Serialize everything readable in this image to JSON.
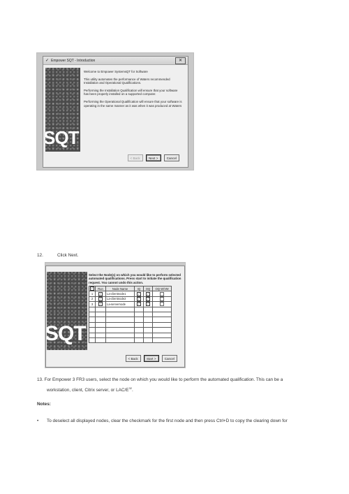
{
  "screenshot_intro": {
    "title": "Empower SQT - Introduction",
    "logo_text": "SQT",
    "paragraphs": [
      "Welcome to Empower SystemsQT for Software",
      "This utility automates the performance of Waters recommended Installation and Operational Qualifications.",
      "Performing the Installation Qualification will ensure that your software has been properly installed on a supported computer.",
      "Performing the Operational Qualification will ensure that your software is operating in the same manner as it was when it was produced at Waters"
    ],
    "buttons": {
      "back": "< Back",
      "next": "Next >",
      "cancel": "Cancel"
    }
  },
  "step12": {
    "number": "12.",
    "text": "Click Next."
  },
  "screenshot_nodes": {
    "logo_text": "SQT",
    "prompt": "Select the Node(s) on which you would like to perform selected automated qualifications. Press start to initiate the qualification request. You cannot undo this action.",
    "columns": [
      "",
      "Run",
      "Node Name",
      "IQ",
      "OQ",
      "OQ W/VM"
    ],
    "rows": [
      {
        "idx": "1",
        "node": "La-clientnode1",
        "run": true,
        "iq": true,
        "oq": true,
        "vm": false
      },
      {
        "idx": "2",
        "node": "La-clientnode2",
        "run": true,
        "iq": true,
        "oq": true,
        "vm": false
      },
      {
        "idx": "3",
        "node": "La-servernode",
        "run": true,
        "iq": true,
        "oq": true,
        "vm": false
      }
    ],
    "empty_rows": 7,
    "buttons": {
      "back": "< Back",
      "start": "Start >",
      "cancel": "Cancel"
    }
  },
  "step13": {
    "number": "13.",
    "line1": "For Empower 3 FR3 users, select the node on which you would like to perform the automated qualification. This can be a",
    "line2": "workstation, client, Citrix server, or LAC/E",
    "line2_sup": "32",
    "line2_end": "."
  },
  "notes": {
    "heading": "Notes:",
    "bullet": "•",
    "items": [
      "To deselect all displayed nodes, clear the checkmark for the first node and then press Ctrl+D to copy the clearing down for"
    ]
  }
}
